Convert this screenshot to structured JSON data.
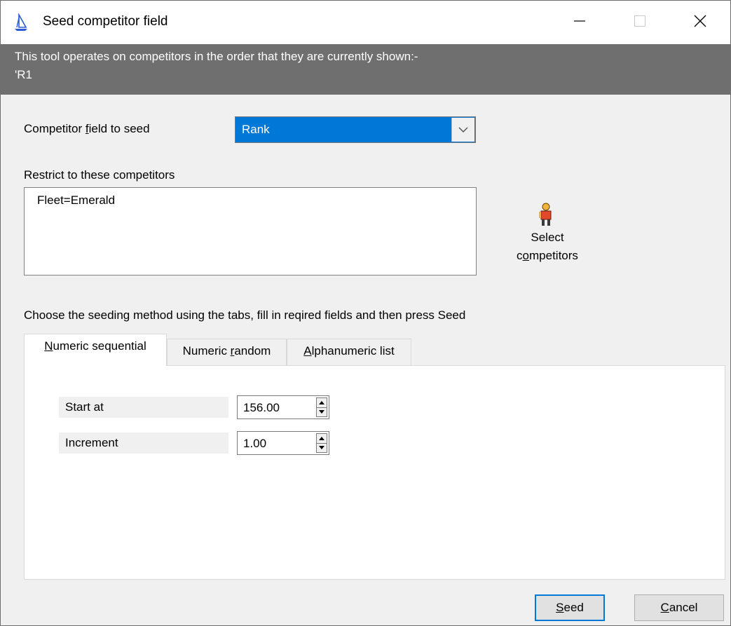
{
  "window": {
    "title": "Seed competitor field",
    "icon": "sailboat-icon",
    "controls": {
      "minimize": "minimize-icon",
      "maximize": "maximize-icon",
      "close": "close-icon"
    }
  },
  "info": {
    "line1": "This tool operates on competitors in the order that they are currently shown:-",
    "line2": "'R1"
  },
  "field_to_seed": {
    "label_before": "Competitor ",
    "label_mnemonic": "f",
    "label_after": "ield to seed",
    "selected": "Rank"
  },
  "restrict": {
    "label": "Restrict to these competitors",
    "items": [
      "Fleet=Emerald"
    ]
  },
  "select_competitors": {
    "icon": "person-icon",
    "line1": "Select",
    "line2_before": "c",
    "line2_mnemonic": "o",
    "line2_after": "mpetitors"
  },
  "instruction": "Choose the seeding method using the tabs, fill in reqired fields and then press Seed",
  "tabs": [
    {
      "before": "",
      "mnemonic": "N",
      "after": "umeric sequential",
      "active": true
    },
    {
      "before": "Numeric ",
      "mnemonic": "r",
      "after": "andom",
      "active": false
    },
    {
      "before": "",
      "mnemonic": "A",
      "after": "lphanumeric list",
      "active": false
    }
  ],
  "sequential": {
    "start_label": "Start at",
    "start_value": "156.00",
    "increment_label": "Increment",
    "increment_value": "1.00"
  },
  "buttons": {
    "seed_mnemonic": "S",
    "seed_rest": "eed",
    "cancel_mnemonic": "C",
    "cancel_rest": "ancel"
  },
  "colors": {
    "accent": "#0078d7",
    "info_bar": "#6f6f6f"
  }
}
